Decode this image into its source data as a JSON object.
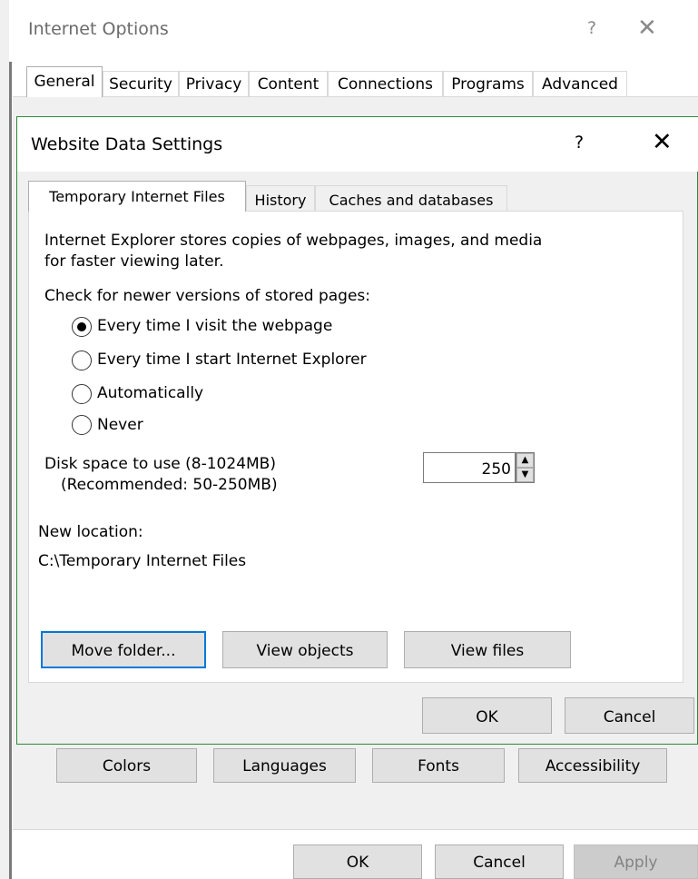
{
  "outer_window": {
    "title": "Internet Options",
    "help": "?",
    "close": "✕",
    "tabs": [
      "General",
      "Security",
      "Privacy",
      "Content",
      "Connections",
      "Programs",
      "Advanced"
    ],
    "buttons": {
      "colors": "Colors",
      "languages": "Languages",
      "fonts": "Fonts",
      "accessibility": "Accessibility"
    },
    "footer": {
      "ok": "OK",
      "cancel": "Cancel",
      "apply": "Apply"
    }
  },
  "dialog": {
    "title": "Website Data Settings",
    "help": "?",
    "close": "✕",
    "tabs": [
      "Temporary Internet Files",
      "History",
      "Caches and databases"
    ],
    "description_line1": "Internet Explorer stores copies of webpages, images, and media",
    "description_line2": "for faster viewing later.",
    "check_label": "Check for newer versions of stored pages:",
    "radio_options": [
      "Every time I visit the webpage",
      "Every time I start Internet Explorer",
      "Automatically",
      "Never"
    ],
    "selected_option": "Every time I visit the webpage",
    "disk_space_label": "Disk space to use (8-1024MB)",
    "disk_space_recommended": "(Recommended: 50-250MB)",
    "disk_space_value": "250",
    "new_location_label": "New location:",
    "new_location_path": "C:\\Temporary Internet Files",
    "buttons": {
      "move_folder": "Move folder...",
      "view_objects": "View objects",
      "view_files": "View files",
      "ok": "OK",
      "cancel": "Cancel"
    }
  },
  "colors": {
    "dialog_border": "#2c8b3a",
    "focus_border": "#0078d7"
  },
  "icons": {
    "spin_up": "spin-up-arrow-icon",
    "spin_down": "spin-down-arrow-icon"
  }
}
